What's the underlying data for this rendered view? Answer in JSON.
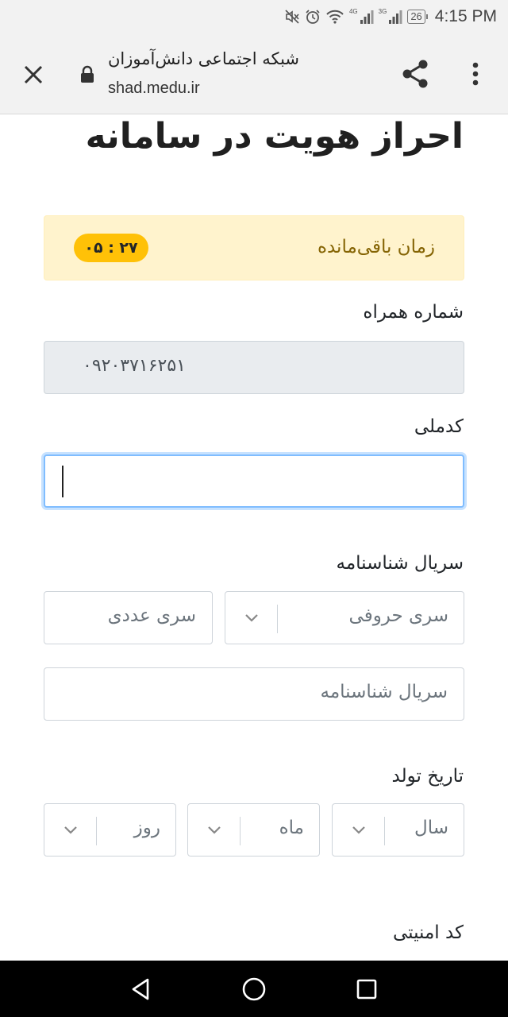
{
  "status_bar": {
    "time": "4:15 PM",
    "battery": "26",
    "network_1": "4G",
    "network_2": "3G"
  },
  "browser": {
    "site_title": "شبکه اجتماعی دانش‌آموزان",
    "url": "shad.medu.ir"
  },
  "page": {
    "title": "احراز هویت در سامانه",
    "timer": {
      "label": "زمان باقی‌مانده",
      "value": "۰۵ : ۲۷"
    },
    "mobile": {
      "label": "شماره همراه",
      "value": "۰۹۲۰۳۷۱۶۲۵۱"
    },
    "national_code": {
      "label": "کدملی",
      "value": ""
    },
    "birth_certificate_serial": {
      "label": "سریال شناسنامه",
      "letter_series_placeholder": "سری حروفی",
      "number_series_placeholder": "سری عددی",
      "serial_placeholder": "سریال شناسنامه"
    },
    "birth_date": {
      "label": "تاریخ تولد",
      "year_placeholder": "سال",
      "month_placeholder": "ماه",
      "day_placeholder": "روز"
    },
    "security_code": {
      "label": "کد امنیتی"
    }
  },
  "icons": {
    "close": "close-icon",
    "lock": "lock-icon",
    "share": "share-icon",
    "more": "more-vert-icon",
    "mute": "mute-icon",
    "alarm": "alarm-icon",
    "wifi": "wifi-icon",
    "signal": "signal-icon",
    "back": "back-triangle-icon",
    "home": "home-circle-icon",
    "recents": "recents-square-icon"
  },
  "colors": {
    "timer_bg": "#fff3cd",
    "timer_text": "#856404",
    "timer_badge": "#ffc107",
    "focus_border": "#80bdff",
    "readonly_bg": "#e9ecef"
  }
}
